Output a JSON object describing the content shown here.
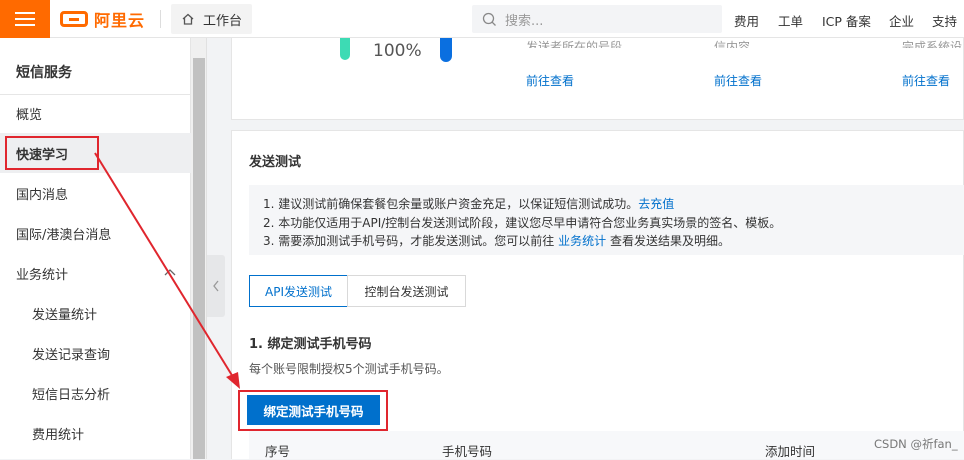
{
  "topbar": {
    "logo_text": "阿里云",
    "workbench": "工作台",
    "search_placeholder": "搜索...",
    "nav": [
      "费用",
      "工单",
      "ICP 备案",
      "企业",
      "支持"
    ]
  },
  "sidebar": {
    "title": "短信服务",
    "items": [
      {
        "label": "概览"
      },
      {
        "label": "快速学习",
        "active": true
      },
      {
        "label": "国内消息"
      },
      {
        "label": "国际/港澳台消息"
      },
      {
        "label": "业务统计",
        "expanded": true
      },
      {
        "label": "发送量统计"
      },
      {
        "label": "发送记录查询"
      },
      {
        "label": "短信日志分析"
      },
      {
        "label": "费用统计"
      }
    ]
  },
  "top_card": {
    "percent": "100%",
    "text_1": "发送者所在的号段。",
    "text_2": "信内容。",
    "text_3": "完成系统设置",
    "link": "前往查看"
  },
  "send_test": {
    "title": "发送测试",
    "notice": {
      "line1_prefix": "1. 建议测试前确保套餐包余量或账户资金充足，以保证短信测试成功。",
      "line1_link": "去充值",
      "line2": "2. 本功能仅适用于API/控制台发送测试阶段，建议您尽早申请符合您业务真实场景的签名、模板。",
      "line3_prefix": "3. 需要添加测试手机号码，才能发送测试。您可以前往",
      "line3_link": "业务统计",
      "line3_suffix": "查看发送结果及明细。"
    },
    "tabs": [
      "API发送测试",
      "控制台发送测试"
    ],
    "section_title": "1. 绑定测试手机号码",
    "section_desc": "每个账号限制授权5个测试手机号码。",
    "bind_button": "绑定测试手机号码",
    "table_headers": [
      "序号",
      "手机号码",
      "添加时间"
    ]
  },
  "watermark": "CSDN @祈fan_",
  "colors": {
    "brand": "#ff6a00",
    "primary": "#0070cc",
    "annotation": "#e0262e"
  }
}
